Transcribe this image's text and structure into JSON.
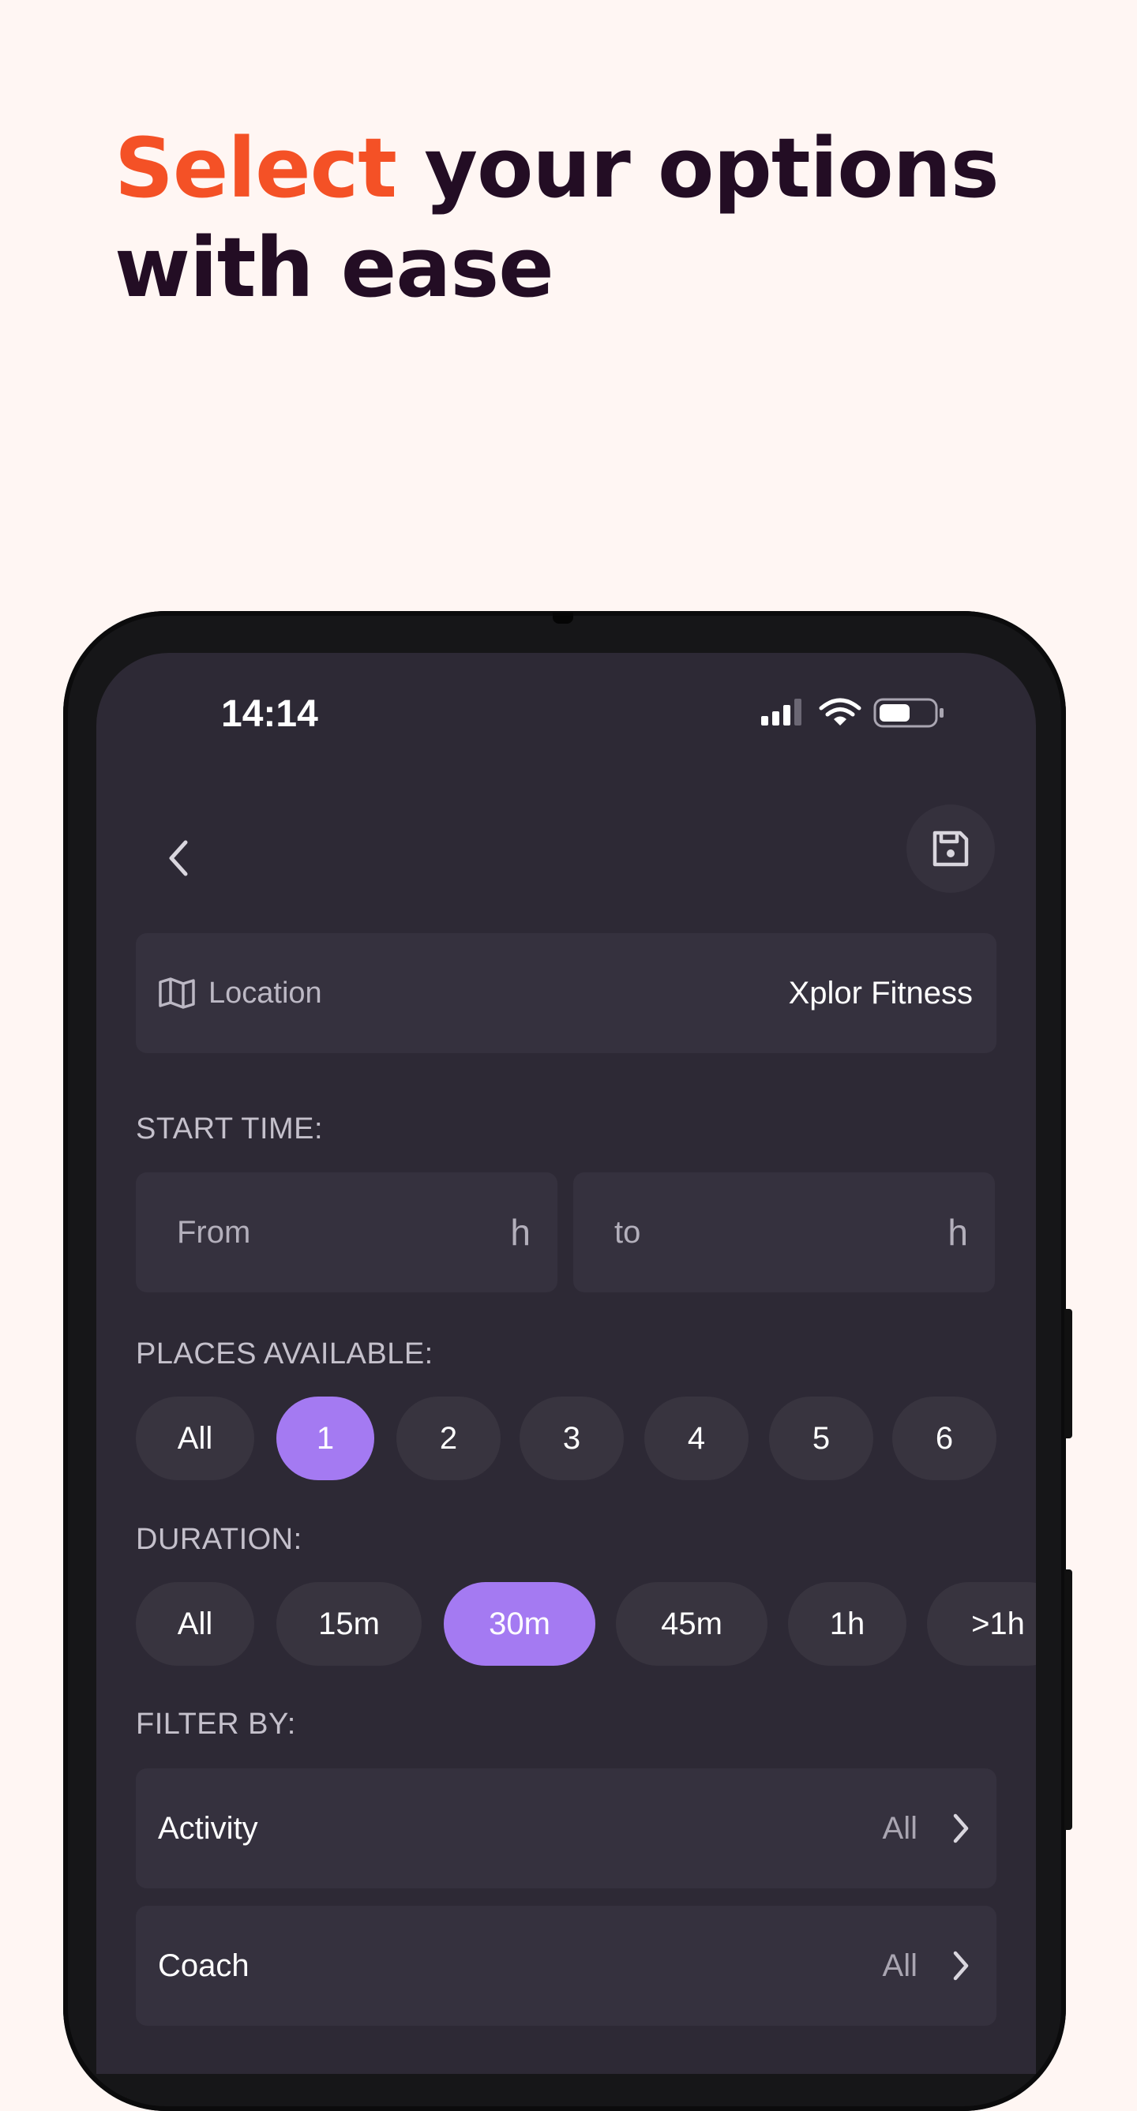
{
  "headline": {
    "accent": "Select",
    "rest_line1": " your options",
    "line2": "with ease"
  },
  "status_bar": {
    "time": "14:14"
  },
  "location": {
    "label": "Location",
    "value": "Xplor Fitness"
  },
  "start_time": {
    "title": "START TIME:",
    "from_placeholder": "From",
    "to_placeholder": "to",
    "unit": "h"
  },
  "places": {
    "title": "PLACES AVAILABLE:",
    "options": [
      "All",
      "1",
      "2",
      "3",
      "4",
      "5",
      "6"
    ],
    "selected": "1"
  },
  "duration": {
    "title": "DURATION:",
    "options": [
      "All",
      "15m",
      "30m",
      "45m",
      "1h",
      ">1h"
    ],
    "selected": "30m"
  },
  "filter": {
    "title": "FILTER BY:",
    "items": [
      {
        "name": "Activity",
        "value": "All"
      },
      {
        "name": "Coach",
        "value": "All"
      }
    ]
  },
  "colors": {
    "accent": "#f45126",
    "selected_chip": "#a47af2",
    "screen_bg": "#2d2935"
  }
}
